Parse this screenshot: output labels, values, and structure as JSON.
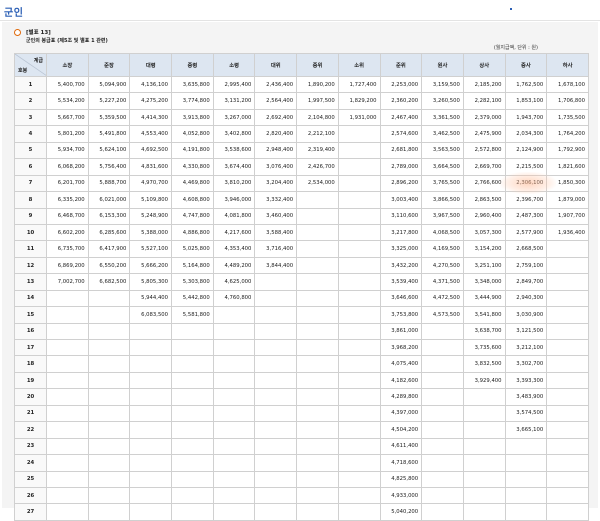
{
  "page": {
    "title": "군인"
  },
  "table_info": {
    "number": "[별표 13]",
    "caption": "군인의 봉급표 (제5조 및 별표 1 관련)",
    "unit_note": "(월지급액, 단위 : 원)"
  },
  "header": {
    "corner_rank": "계급",
    "corner_step": "호봉",
    "ranks": [
      "소장",
      "준장",
      "대령",
      "중령",
      "소령",
      "대위",
      "중위",
      "소위",
      "준위",
      "원사",
      "상사",
      "중사",
      "하사"
    ]
  },
  "rows": [
    {
      "step": "1",
      "cells": [
        "5,400,700",
        "5,094,900",
        "4,136,100",
        "3,635,800",
        "2,995,400",
        "2,436,400",
        "1,890,200",
        "1,727,400",
        "2,253,000",
        "3,159,500",
        "2,185,200",
        "1,762,500",
        "1,678,100"
      ]
    },
    {
      "step": "2",
      "cells": [
        "5,534,200",
        "5,227,200",
        "4,275,200",
        "3,774,800",
        "3,131,200",
        "2,564,400",
        "1,997,500",
        "1,829,200",
        "2,360,200",
        "3,260,500",
        "2,282,100",
        "1,853,100",
        "1,706,800"
      ]
    },
    {
      "step": "3",
      "cells": [
        "5,667,700",
        "5,359,500",
        "4,414,300",
        "3,913,800",
        "3,267,000",
        "2,692,400",
        "2,104,800",
        "1,931,000",
        "2,467,400",
        "3,361,500",
        "2,379,000",
        "1,943,700",
        "1,735,500"
      ]
    },
    {
      "step": "4",
      "cells": [
        "5,801,200",
        "5,491,800",
        "4,553,400",
        "4,052,800",
        "3,402,800",
        "2,820,400",
        "2,212,100",
        "",
        "2,574,600",
        "3,462,500",
        "2,475,900",
        "2,034,300",
        "1,764,200"
      ]
    },
    {
      "step": "5",
      "cells": [
        "5,934,700",
        "5,624,100",
        "4,692,500",
        "4,191,800",
        "3,538,600",
        "2,948,400",
        "2,319,400",
        "",
        "2,681,800",
        "3,563,500",
        "2,572,800",
        "2,124,900",
        "1,792,900"
      ]
    },
    {
      "step": "6",
      "cells": [
        "6,068,200",
        "5,756,400",
        "4,831,600",
        "4,330,800",
        "3,674,400",
        "3,076,400",
        "2,426,700",
        "",
        "2,789,000",
        "3,664,500",
        "2,669,700",
        "2,215,500",
        "1,821,600"
      ]
    },
    {
      "step": "7",
      "cells": [
        "6,201,700",
        "5,888,700",
        "4,970,700",
        "4,469,800",
        "3,810,200",
        "3,204,400",
        "2,534,000",
        "",
        "2,896,200",
        "3,765,500",
        "2,766,600",
        "2,306,100",
        "1,850,300"
      ]
    },
    {
      "step": "8",
      "cells": [
        "6,335,200",
        "6,021,000",
        "5,109,800",
        "4,608,800",
        "3,946,000",
        "3,332,400",
        "",
        "",
        "3,003,400",
        "3,866,500",
        "2,863,500",
        "2,396,700",
        "1,879,000"
      ]
    },
    {
      "step": "9",
      "cells": [
        "6,468,700",
        "6,153,300",
        "5,248,900",
        "4,747,800",
        "4,081,800",
        "3,460,400",
        "",
        "",
        "3,110,600",
        "3,967,500",
        "2,960,400",
        "2,487,300",
        "1,907,700"
      ]
    },
    {
      "step": "10",
      "cells": [
        "6,602,200",
        "6,285,600",
        "5,388,000",
        "4,886,800",
        "4,217,600",
        "3,588,400",
        "",
        "",
        "3,217,800",
        "4,068,500",
        "3,057,300",
        "2,577,900",
        "1,936,400"
      ]
    },
    {
      "step": "11",
      "cells": [
        "6,735,700",
        "6,417,900",
        "5,527,100",
        "5,025,800",
        "4,353,400",
        "3,716,400",
        "",
        "",
        "3,325,000",
        "4,169,500",
        "3,154,200",
        "2,668,500",
        ""
      ]
    },
    {
      "step": "12",
      "cells": [
        "6,869,200",
        "6,550,200",
        "5,666,200",
        "5,164,800",
        "4,489,200",
        "3,844,400",
        "",
        "",
        "3,432,200",
        "4,270,500",
        "3,251,100",
        "2,759,100",
        ""
      ]
    },
    {
      "step": "13",
      "cells": [
        "7,002,700",
        "6,682,500",
        "5,805,300",
        "5,303,800",
        "4,625,000",
        "",
        "",
        "",
        "3,539,400",
        "4,371,500",
        "3,348,000",
        "2,849,700",
        ""
      ]
    },
    {
      "step": "14",
      "cells": [
        "",
        "",
        "5,944,400",
        "5,442,800",
        "4,760,800",
        "",
        "",
        "",
        "3,646,600",
        "4,472,500",
        "3,444,900",
        "2,940,300",
        ""
      ]
    },
    {
      "step": "15",
      "cells": [
        "",
        "",
        "6,083,500",
        "5,581,800",
        "",
        "",
        "",
        "",
        "3,753,800",
        "4,573,500",
        "3,541,800",
        "3,030,900",
        ""
      ]
    },
    {
      "step": "16",
      "cells": [
        "",
        "",
        "",
        "",
        "",
        "",
        "",
        "",
        "3,861,000",
        "",
        "3,638,700",
        "3,121,500",
        ""
      ]
    },
    {
      "step": "17",
      "cells": [
        "",
        "",
        "",
        "",
        "",
        "",
        "",
        "",
        "3,968,200",
        "",
        "3,735,600",
        "3,212,100",
        ""
      ]
    },
    {
      "step": "18",
      "cells": [
        "",
        "",
        "",
        "",
        "",
        "",
        "",
        "",
        "4,075,400",
        "",
        "3,832,500",
        "3,302,700",
        ""
      ]
    },
    {
      "step": "19",
      "cells": [
        "",
        "",
        "",
        "",
        "",
        "",
        "",
        "",
        "4,182,600",
        "",
        "3,929,400",
        "3,393,300",
        ""
      ]
    },
    {
      "step": "20",
      "cells": [
        "",
        "",
        "",
        "",
        "",
        "",
        "",
        "",
        "4,289,800",
        "",
        "",
        "3,483,900",
        ""
      ]
    },
    {
      "step": "21",
      "cells": [
        "",
        "",
        "",
        "",
        "",
        "",
        "",
        "",
        "4,397,000",
        "",
        "",
        "3,574,500",
        ""
      ]
    },
    {
      "step": "22",
      "cells": [
        "",
        "",
        "",
        "",
        "",
        "",
        "",
        "",
        "4,504,200",
        "",
        "",
        "3,665,100",
        ""
      ]
    },
    {
      "step": "23",
      "cells": [
        "",
        "",
        "",
        "",
        "",
        "",
        "",
        "",
        "4,611,400",
        "",
        "",
        "",
        ""
      ]
    },
    {
      "step": "24",
      "cells": [
        "",
        "",
        "",
        "",
        "",
        "",
        "",
        "",
        "4,718,600",
        "",
        "",
        "",
        ""
      ]
    },
    {
      "step": "25",
      "cells": [
        "",
        "",
        "",
        "",
        "",
        "",
        "",
        "",
        "4,825,800",
        "",
        "",
        "",
        ""
      ]
    },
    {
      "step": "26",
      "cells": [
        "",
        "",
        "",
        "",
        "",
        "",
        "",
        "",
        "4,933,000",
        "",
        "",
        "",
        ""
      ]
    },
    {
      "step": "27",
      "cells": [
        "",
        "",
        "",
        "",
        "",
        "",
        "",
        "",
        "5,040,200",
        "",
        "",
        "",
        ""
      ]
    }
  ]
}
